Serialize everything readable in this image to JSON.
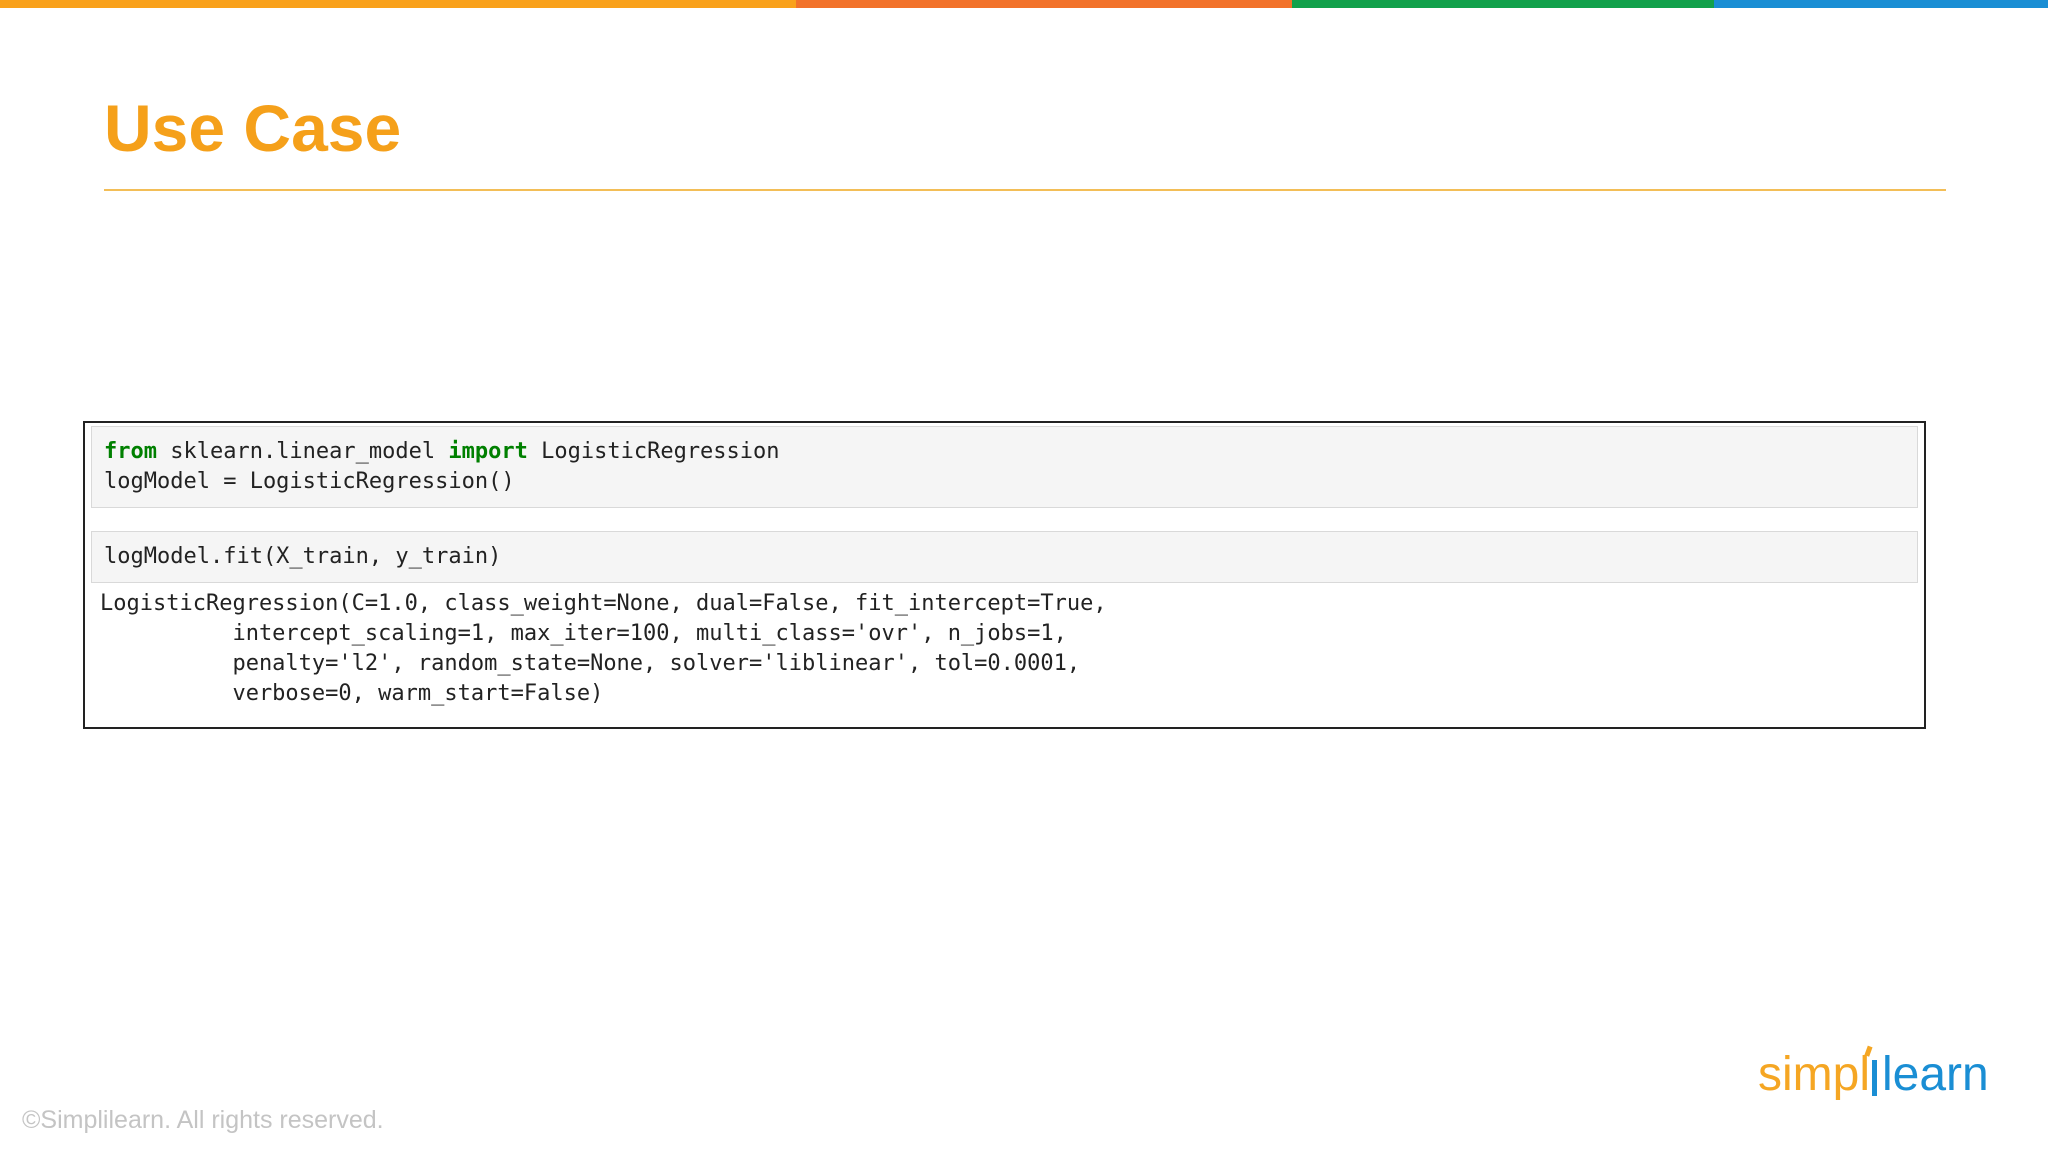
{
  "colors": {
    "bar_orange": "#f9a11b",
    "bar_red_orange": "#f2722a",
    "bar_green": "#12a14b",
    "bar_blue": "#1a8ed4",
    "title": "#f5a01a",
    "rule": "#f3be57",
    "keyword": "#008000",
    "logo_orange": "#f5a623",
    "logo_blue": "#1a8ed4"
  },
  "slide": {
    "title": "Use Case",
    "copyright": "©Simplilearn. All rights reserved."
  },
  "logo": {
    "part1": "simpl",
    "part2": "learn",
    "icon": "simplilearn-logo-icon"
  },
  "notebook": {
    "cell1": {
      "line1": {
        "kw_from": "from",
        "module": " sklearn.linear_model ",
        "kw_import": "import",
        "name": " LogisticRegression"
      },
      "line2": "logModel = LogisticRegression()"
    },
    "cell2": {
      "line1": "logModel.fit(X_train, y_train)"
    },
    "output": [
      "LogisticRegression(C=1.0, class_weight=None, dual=False, fit_intercept=True,",
      "          intercept_scaling=1, max_iter=100, multi_class='ovr', n_jobs=1,",
      "          penalty='l2', random_state=None, solver='liblinear', tol=0.0001,",
      "          verbose=0, warm_start=False)"
    ]
  }
}
